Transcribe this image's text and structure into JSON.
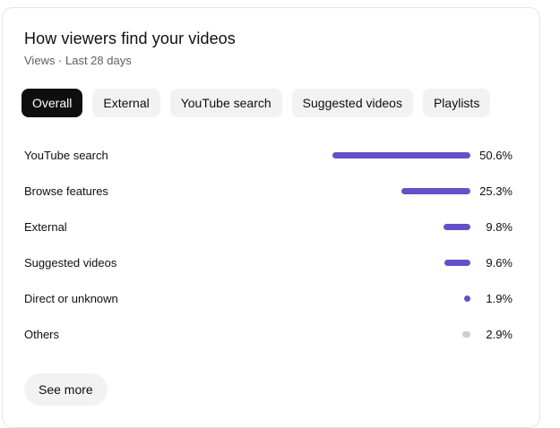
{
  "card": {
    "title": "How viewers find your videos",
    "subtitle": "Views · Last 28 days"
  },
  "tabs": [
    {
      "label": "Overall",
      "active": true
    },
    {
      "label": "External",
      "active": false
    },
    {
      "label": "YouTube search",
      "active": false
    },
    {
      "label": "Suggested videos",
      "active": false
    },
    {
      "label": "Playlists",
      "active": false
    }
  ],
  "sources": [
    {
      "label": "YouTube search",
      "value": "50.6%",
      "percent": 50.6,
      "color": "#6450c8"
    },
    {
      "label": "Browse features",
      "value": "25.3%",
      "percent": 25.3,
      "color": "#6450c8"
    },
    {
      "label": "External",
      "value": "9.8%",
      "percent": 9.8,
      "color": "#6450c8"
    },
    {
      "label": "Suggested videos",
      "value": "9.6%",
      "percent": 9.6,
      "color": "#6450c8"
    },
    {
      "label": "Direct or unknown",
      "value": "1.9%",
      "percent": 1.9,
      "color": "#6450c8"
    },
    {
      "label": "Others",
      "value": "2.9%",
      "percent": 2.9,
      "color": "#cccccc"
    }
  ],
  "see_more_label": "See more"
}
